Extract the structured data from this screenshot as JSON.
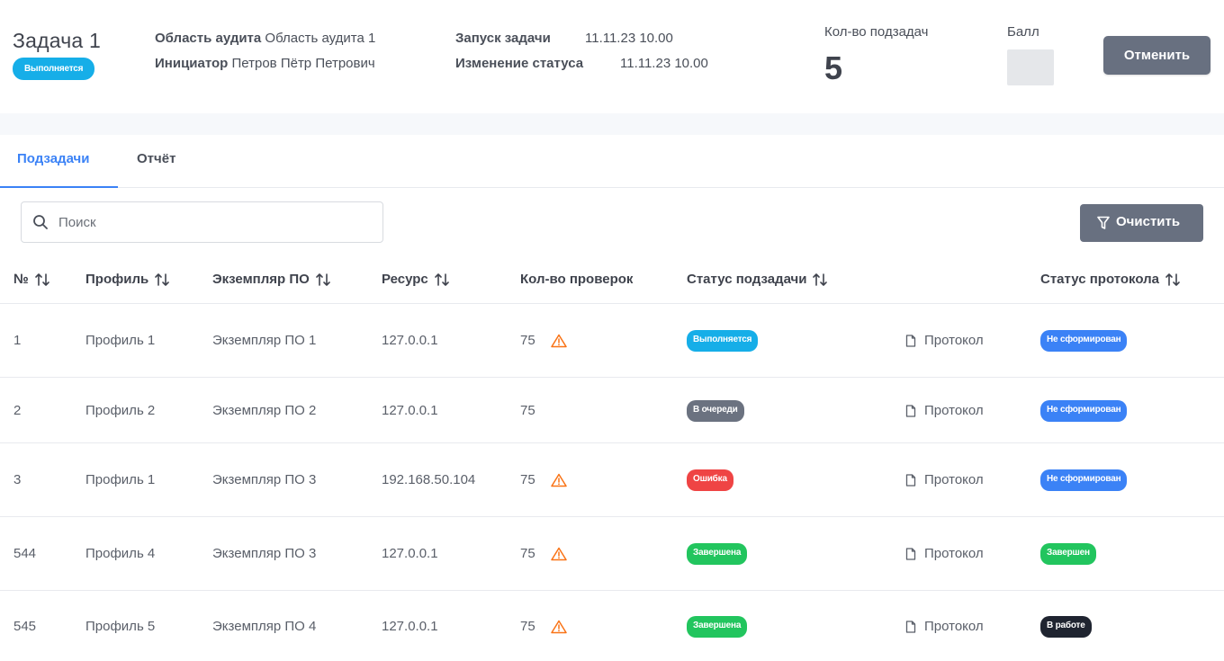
{
  "header": {
    "title": "Задача 1",
    "status": "Выполняется",
    "audit_area_label": "Область аудита",
    "audit_area_value": "Область аудита 1",
    "initiator_label": "Инициатор",
    "initiator_value": "Петров Пётр Петрович",
    "launch_label": "Запуск задачи",
    "launch_value": "11.11.23 10.00",
    "status_change_label": "Изменение статуса",
    "status_change_value": "11.11.23 10.00",
    "subtasks_label": "Кол-во подзадач",
    "subtasks_count": "5",
    "score_label": "Балл",
    "cancel_label": "Отменить"
  },
  "tabs": [
    {
      "label": "Подзадачи",
      "active": true
    },
    {
      "label": "Отчёт",
      "active": false
    }
  ],
  "toolbar": {
    "search_placeholder": "Поиск",
    "clear_label": "Очистить"
  },
  "table": {
    "columns": [
      "№",
      "Профиль",
      "Экземпляр ПО",
      "Ресурс",
      "Кол-во проверок",
      "Статус подзадачи",
      "Статус протокола"
    ],
    "protocol_label": "Протокол",
    "rows": [
      {
        "num": "1",
        "profile": "Профиль 1",
        "instance": "Экземпляр ПО 1",
        "resource": "127.0.0.1",
        "checks": "75",
        "warning": true,
        "subtask_status": "Выполняется",
        "subtask_color": "blue",
        "protocol_status": "Не сформирован",
        "protocol_color": "navy"
      },
      {
        "num": "2",
        "profile": "Профиль 2",
        "instance": "Экземпляр ПО 2",
        "resource": "127.0.0.1",
        "checks": "75",
        "warning": false,
        "subtask_status": "В очереди",
        "subtask_color": "gray",
        "protocol_status": "Не сформирован",
        "protocol_color": "navy"
      },
      {
        "num": "3",
        "profile": "Профиль 1",
        "instance": "Экземпляр ПО 3",
        "resource": "192.168.50.104",
        "checks": "75",
        "warning": true,
        "subtask_status": "Ошибка",
        "subtask_color": "red",
        "protocol_status": "Не сформирован",
        "protocol_color": "navy"
      },
      {
        "num": "544",
        "profile": "Профиль 4",
        "instance": "Экземпляр ПО 3",
        "resource": "127.0.0.1",
        "checks": "75",
        "warning": true,
        "subtask_status": "Завершена",
        "subtask_color": "green",
        "protocol_status": "Завершен",
        "protocol_color": "green"
      },
      {
        "num": "545",
        "profile": "Профиль 5",
        "instance": "Экземпляр ПО 4",
        "resource": "127.0.0.1",
        "checks": "75",
        "warning": true,
        "subtask_status": "Завершена",
        "subtask_color": "green",
        "protocol_status": "В работе",
        "protocol_color": "black"
      }
    ]
  },
  "colors": {
    "accent": "#3b82f6",
    "status_running": "#16aee8",
    "status_queue": "#6b7280",
    "status_error": "#ef4444",
    "status_done": "#22c55e",
    "status_in_work": "#1f2430",
    "button_bg": "#687080",
    "warning": "#f97316"
  }
}
